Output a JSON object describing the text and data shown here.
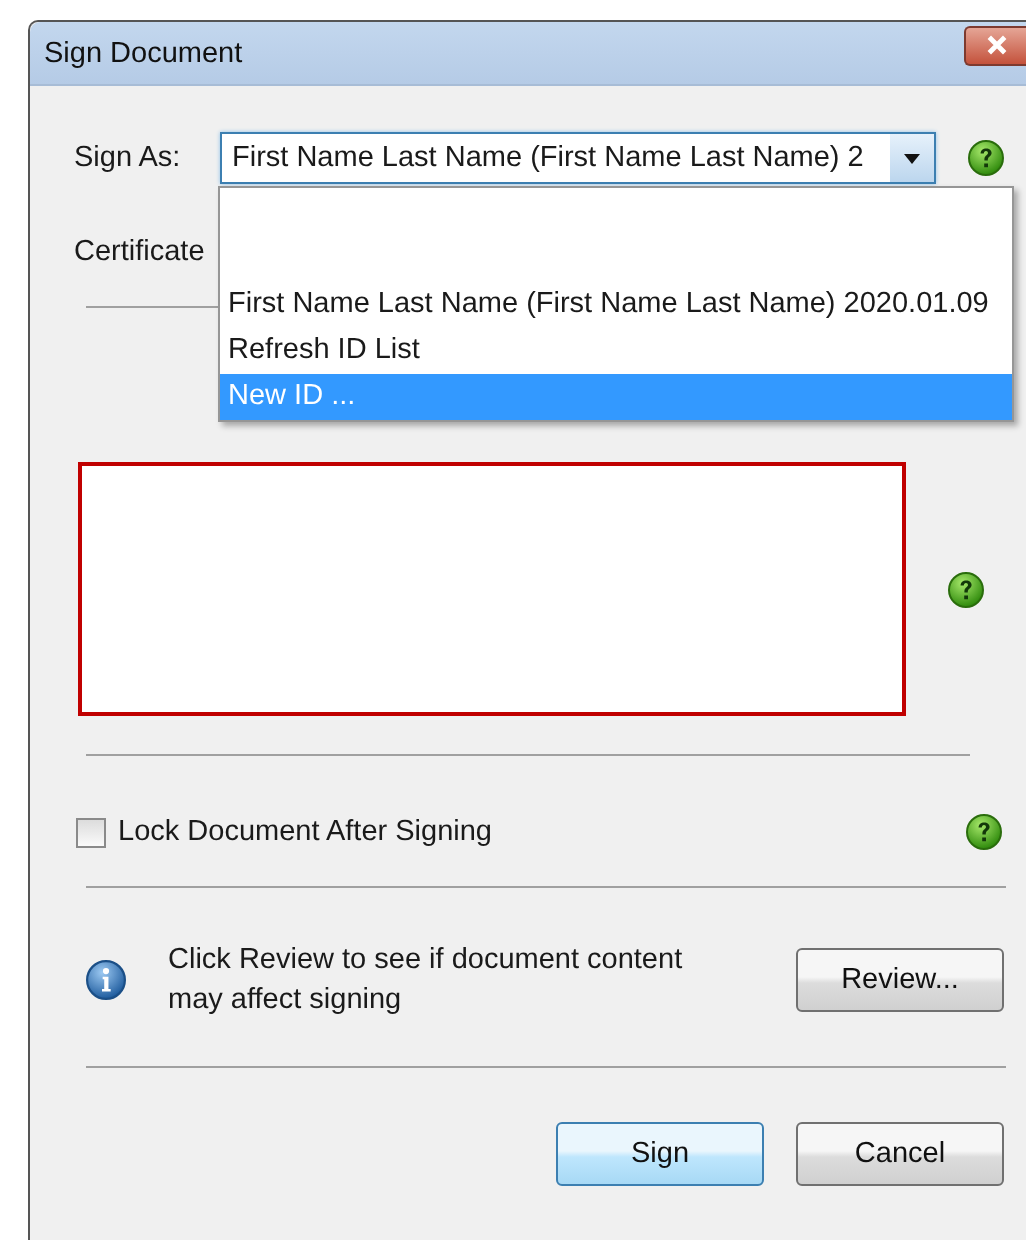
{
  "window": {
    "title": "Sign Document"
  },
  "sign_as": {
    "label": "Sign As:",
    "value": "First Name Last Name (First Name Last Name) 2"
  },
  "dropdown": {
    "expanded": true,
    "items": [
      {
        "label": "First Name Last Name (First Name Last Name) 2020.01.09",
        "selected": false
      },
      {
        "label": "Refresh ID List",
        "selected": false
      },
      {
        "label": "New ID ...",
        "selected": true
      }
    ]
  },
  "certificate": {
    "label": "Certificate"
  },
  "lock": {
    "label": "Lock Document After Signing",
    "checked": false
  },
  "info": {
    "text": "Click Review to see if document content may affect signing",
    "button": "Review..."
  },
  "buttons": [
    {
      "label": "Sign",
      "default": true
    },
    {
      "label": "Cancel",
      "default": false
    }
  ]
}
